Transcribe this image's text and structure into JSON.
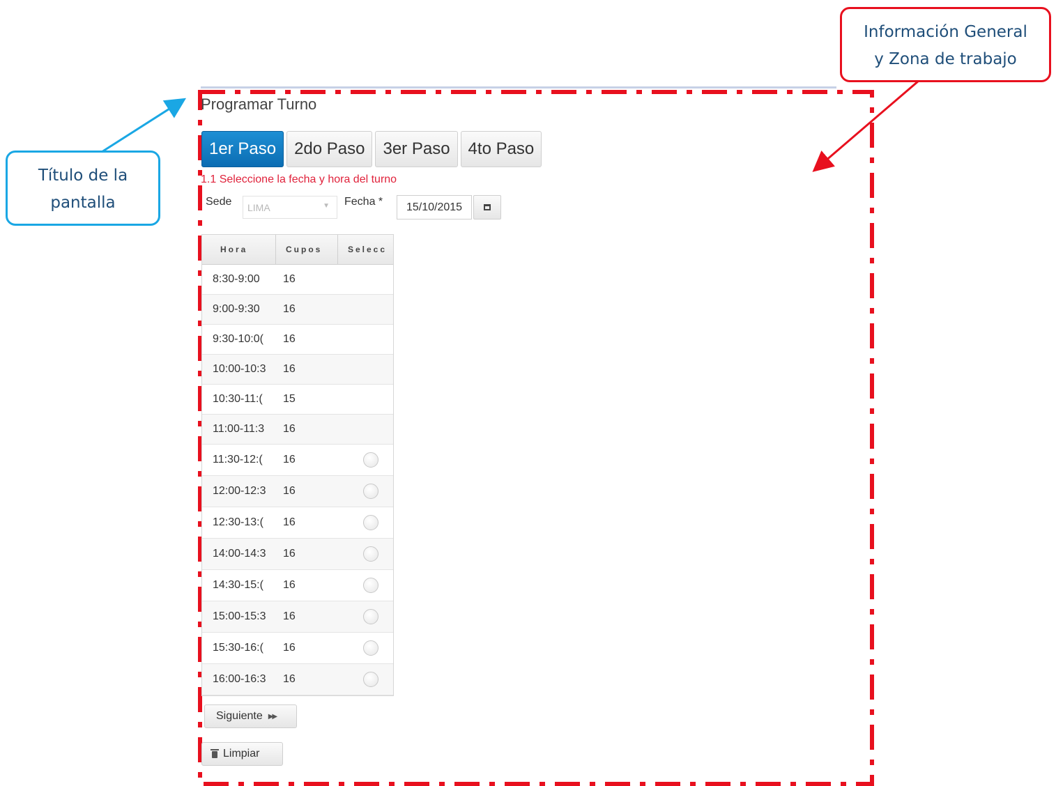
{
  "annotations": {
    "screen_title_callout": [
      "Título de la",
      "pantalla"
    ],
    "info_zone_callout": [
      "Información General",
      "y Zona de trabajo"
    ]
  },
  "page": {
    "title": "Programar Turno",
    "steps": [
      "1er Paso",
      "2do Paso",
      "3er Paso",
      "4to Paso"
    ],
    "active_step": "1er Paso",
    "instruction": "1.1 Seleccione la fecha y hora del turno"
  },
  "form": {
    "sede_label": "Sede",
    "sede_value": "LIMA",
    "fecha_label": "Fecha *",
    "fecha_value": "15/10/2015"
  },
  "table": {
    "headers": [
      "Hora",
      "Cupos",
      "Selecc"
    ],
    "rows": [
      {
        "hora": "8:30-9:00",
        "cupos": "16",
        "selectable": false
      },
      {
        "hora": "9:00-9:30",
        "cupos": "16",
        "selectable": false
      },
      {
        "hora": "9:30-10:0(",
        "cupos": "16",
        "selectable": false
      },
      {
        "hora": "10:00-10:3",
        "cupos": "16",
        "selectable": false
      },
      {
        "hora": "10:30-11:(",
        "cupos": "15",
        "selectable": false
      },
      {
        "hora": "11:00-11:3",
        "cupos": "16",
        "selectable": false
      },
      {
        "hora": "11:30-12:(",
        "cupos": "16",
        "selectable": true
      },
      {
        "hora": "12:00-12:3",
        "cupos": "16",
        "selectable": true
      },
      {
        "hora": "12:30-13:(",
        "cupos": "16",
        "selectable": true
      },
      {
        "hora": "14:00-14:3",
        "cupos": "16",
        "selectable": true
      },
      {
        "hora": "14:30-15:(",
        "cupos": "16",
        "selectable": true
      },
      {
        "hora": "15:00-15:3",
        "cupos": "16",
        "selectable": true
      },
      {
        "hora": "15:30-16:(",
        "cupos": "16",
        "selectable": true
      },
      {
        "hora": "16:00-16:3",
        "cupos": "16",
        "selectable": true
      }
    ]
  },
  "buttons": {
    "next_label": "Siguiente",
    "clear_label": "Limpiar"
  },
  "colors": {
    "active_step": "#0b6db3",
    "instruction": "#e0223b",
    "callout_blue": "#1aa7e4",
    "callout_red": "#e8101e",
    "callout_text": "#1f4e79"
  },
  "icons": {
    "calendar": "calendar-icon",
    "next": "fast-forward-icon",
    "clear": "trash-icon"
  }
}
